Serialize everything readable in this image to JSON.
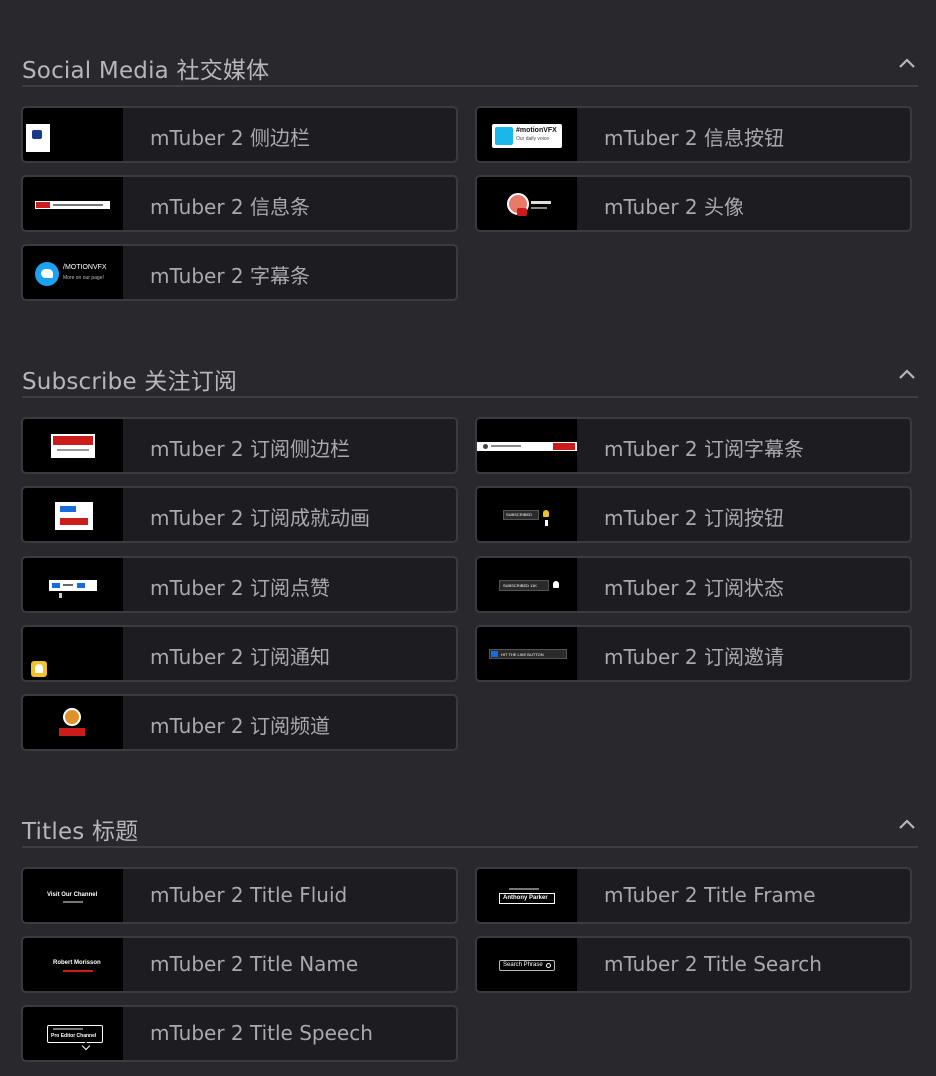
{
  "sections": [
    {
      "title": "Social Media 社交媒体",
      "items": [
        {
          "label": "mTuber 2 侧边栏"
        },
        {
          "label": "mTuber 2 信息按钮"
        },
        {
          "label": "mTuber 2 信息条"
        },
        {
          "label": "mTuber 2 头像"
        },
        {
          "label": "mTuber 2 字幕条"
        }
      ]
    },
    {
      "title": "Subscribe 关注订阅",
      "items": [
        {
          "label": "mTuber 2 订阅侧边栏"
        },
        {
          "label": "mTuber 2 订阅字幕条"
        },
        {
          "label": "mTuber 2 订阅成就动画"
        },
        {
          "label": "mTuber 2 订阅按钮"
        },
        {
          "label": "mTuber 2 订阅点赞"
        },
        {
          "label": "mTuber 2 订阅状态"
        },
        {
          "label": "mTuber 2 订阅通知"
        },
        {
          "label": "mTuber 2 订阅邀请"
        },
        {
          "label": "mTuber 2 订阅频道"
        }
      ]
    },
    {
      "title": "Titles 标题",
      "items": [
        {
          "label": "mTuber 2 Title Fluid"
        },
        {
          "label": "mTuber 2 Title Frame"
        },
        {
          "label": "mTuber 2 Title Name"
        },
        {
          "label": "mTuber 2 Title Search"
        },
        {
          "label": "mTuber 2 Title Speech"
        }
      ]
    }
  ],
  "thumb_text": {
    "motionvfx_tag": "#motionVFX",
    "motionvfx_sub": "Our daily voice",
    "twitter_handle": "/MOTIONVFX",
    "twitter_sub": "More on our page!",
    "subscribed": "SUBSCRIBED",
    "subscribed_count": "SUBSCRIBED 11K",
    "hit_like": "HIT THE LIKE BUTTON",
    "visit_channel": "Visit Our Channel",
    "anthony": "Anthony Parker",
    "robert": "Robert Morisson",
    "search_phrase": "Search Phrase",
    "pro_editor": "Pro Editor Channel"
  },
  "colors": {
    "background": "#28282d",
    "card": "#1d1d21",
    "youtube_red": "#cc1b1b",
    "vimeo_blue": "#1ab7ea",
    "twitter_blue": "#1da1f2"
  }
}
